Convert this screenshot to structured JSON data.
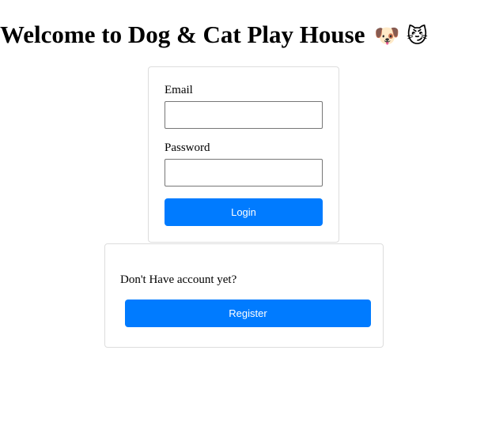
{
  "header": {
    "title": "Welcome to Dog & Cat Play House",
    "emojis": "🐶 😼"
  },
  "login_form": {
    "email_label": "Email",
    "email_value": "",
    "password_label": "Password",
    "password_value": "",
    "login_button": "Login"
  },
  "register_panel": {
    "prompt": "Don't Have account yet?",
    "register_button": "Register"
  },
  "colors": {
    "primary_button": "#007bff",
    "card_border": "#dddddd"
  }
}
